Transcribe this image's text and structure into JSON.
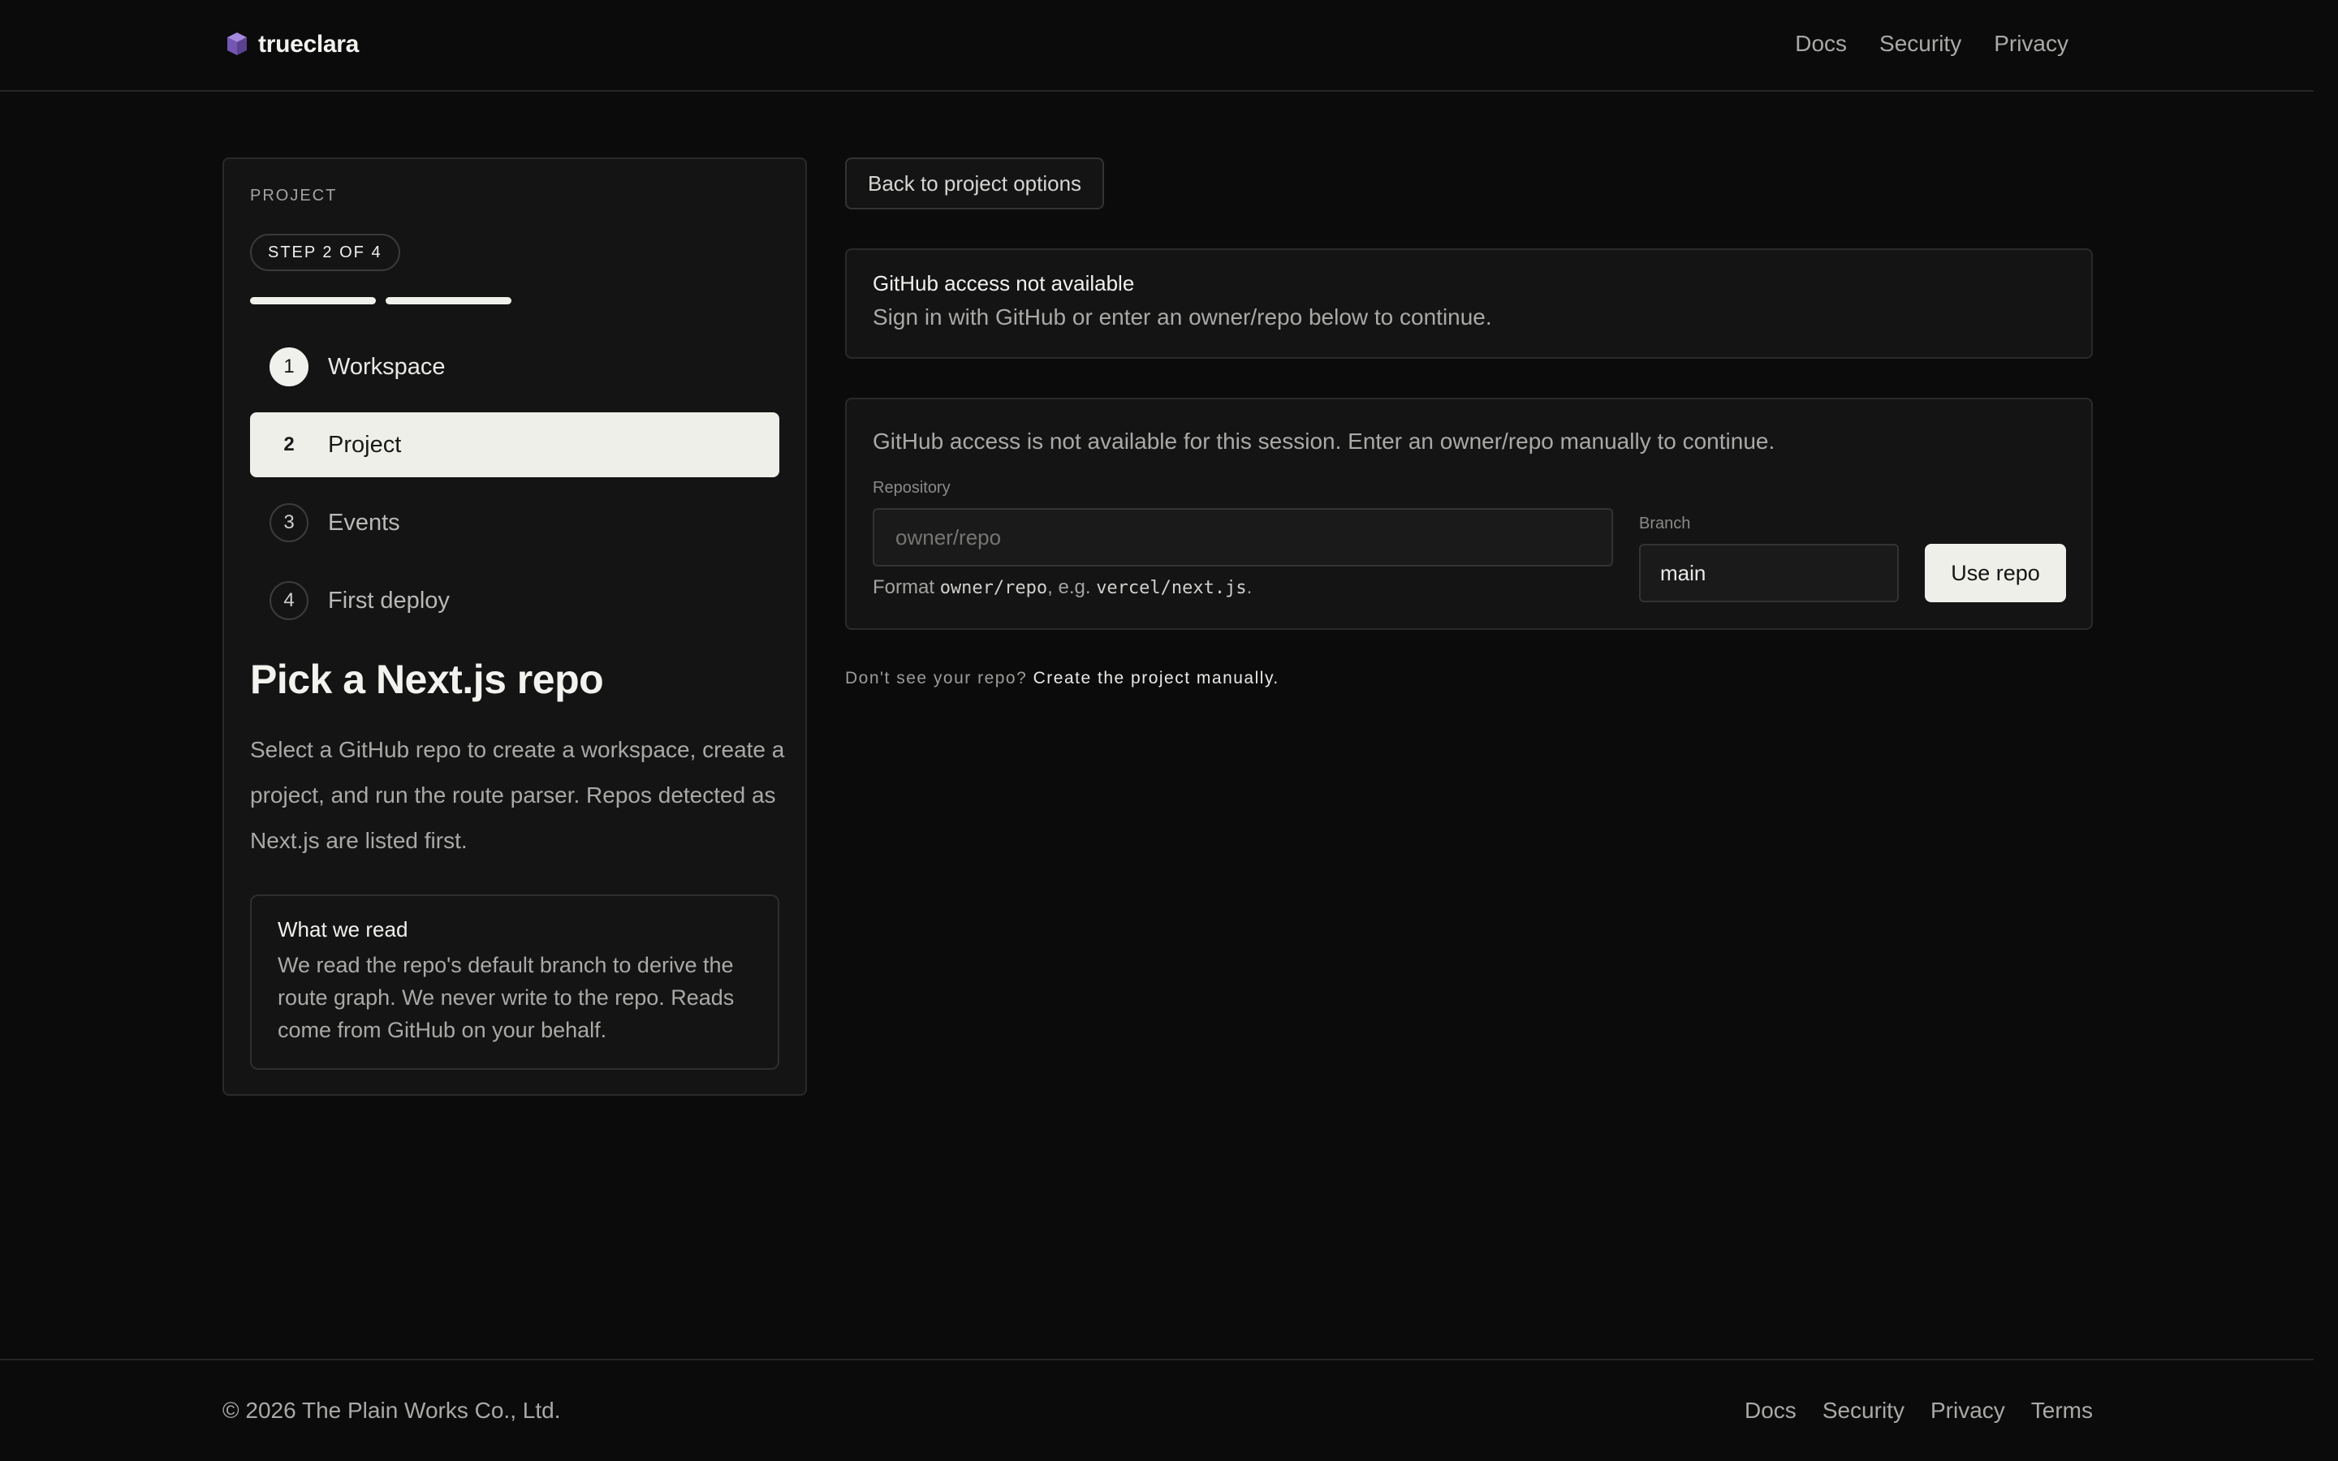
{
  "header": {
    "brand": "trueclara",
    "nav": [
      "Docs",
      "Security",
      "Privacy"
    ]
  },
  "sidebar": {
    "eyebrow": "PROJECT",
    "step_chip": "STEP 2 OF 4",
    "progress_completed": 2,
    "progress_total": 4,
    "steps": [
      {
        "num": "1",
        "label": "Workspace",
        "state": "done"
      },
      {
        "num": "2",
        "label": "Project",
        "state": "active"
      },
      {
        "num": "3",
        "label": "Events",
        "state": "upcoming"
      },
      {
        "num": "4",
        "label": "First deploy",
        "state": "upcoming"
      }
    ],
    "title": "Pick a Next.js repo",
    "description": "Select a GitHub repo to create a workspace, create a project, and run the route parser. Repos detected as Next.js are listed first.",
    "read_box": {
      "title": "What we read",
      "text": "We read the repo's default branch to derive the route graph. We never write to the repo. Reads come from GitHub on your behalf."
    }
  },
  "main": {
    "back_button": "Back to project options",
    "notice": {
      "title": "GitHub access not available",
      "text": "Sign in with GitHub or enter an owner/repo below to continue."
    },
    "manual": {
      "intro": "GitHub access is not available for this session. Enter an owner/repo manually to continue.",
      "repo_label": "Repository",
      "repo_placeholder": "owner/repo",
      "repo_value": "",
      "hint_prefix": "Format ",
      "hint_code1": "owner/repo",
      "hint_mid": ", e.g. ",
      "hint_code2": "vercel/next.js",
      "hint_suffix": ".",
      "branch_label": "Branch",
      "branch_value": "main",
      "use_button": "Use repo"
    },
    "dont_see": "Don't see your repo?",
    "create_manually": "Create the project manually."
  },
  "footer": {
    "copyright": "© 2026 The Plain Works Co., Ltd.",
    "nav": [
      "Docs",
      "Security",
      "Privacy",
      "Terms"
    ]
  },
  "colors": {
    "background": "#0b0b0c",
    "card": "#141415",
    "active_step": "#efefea",
    "brand_mark": "#8b6fc9"
  }
}
